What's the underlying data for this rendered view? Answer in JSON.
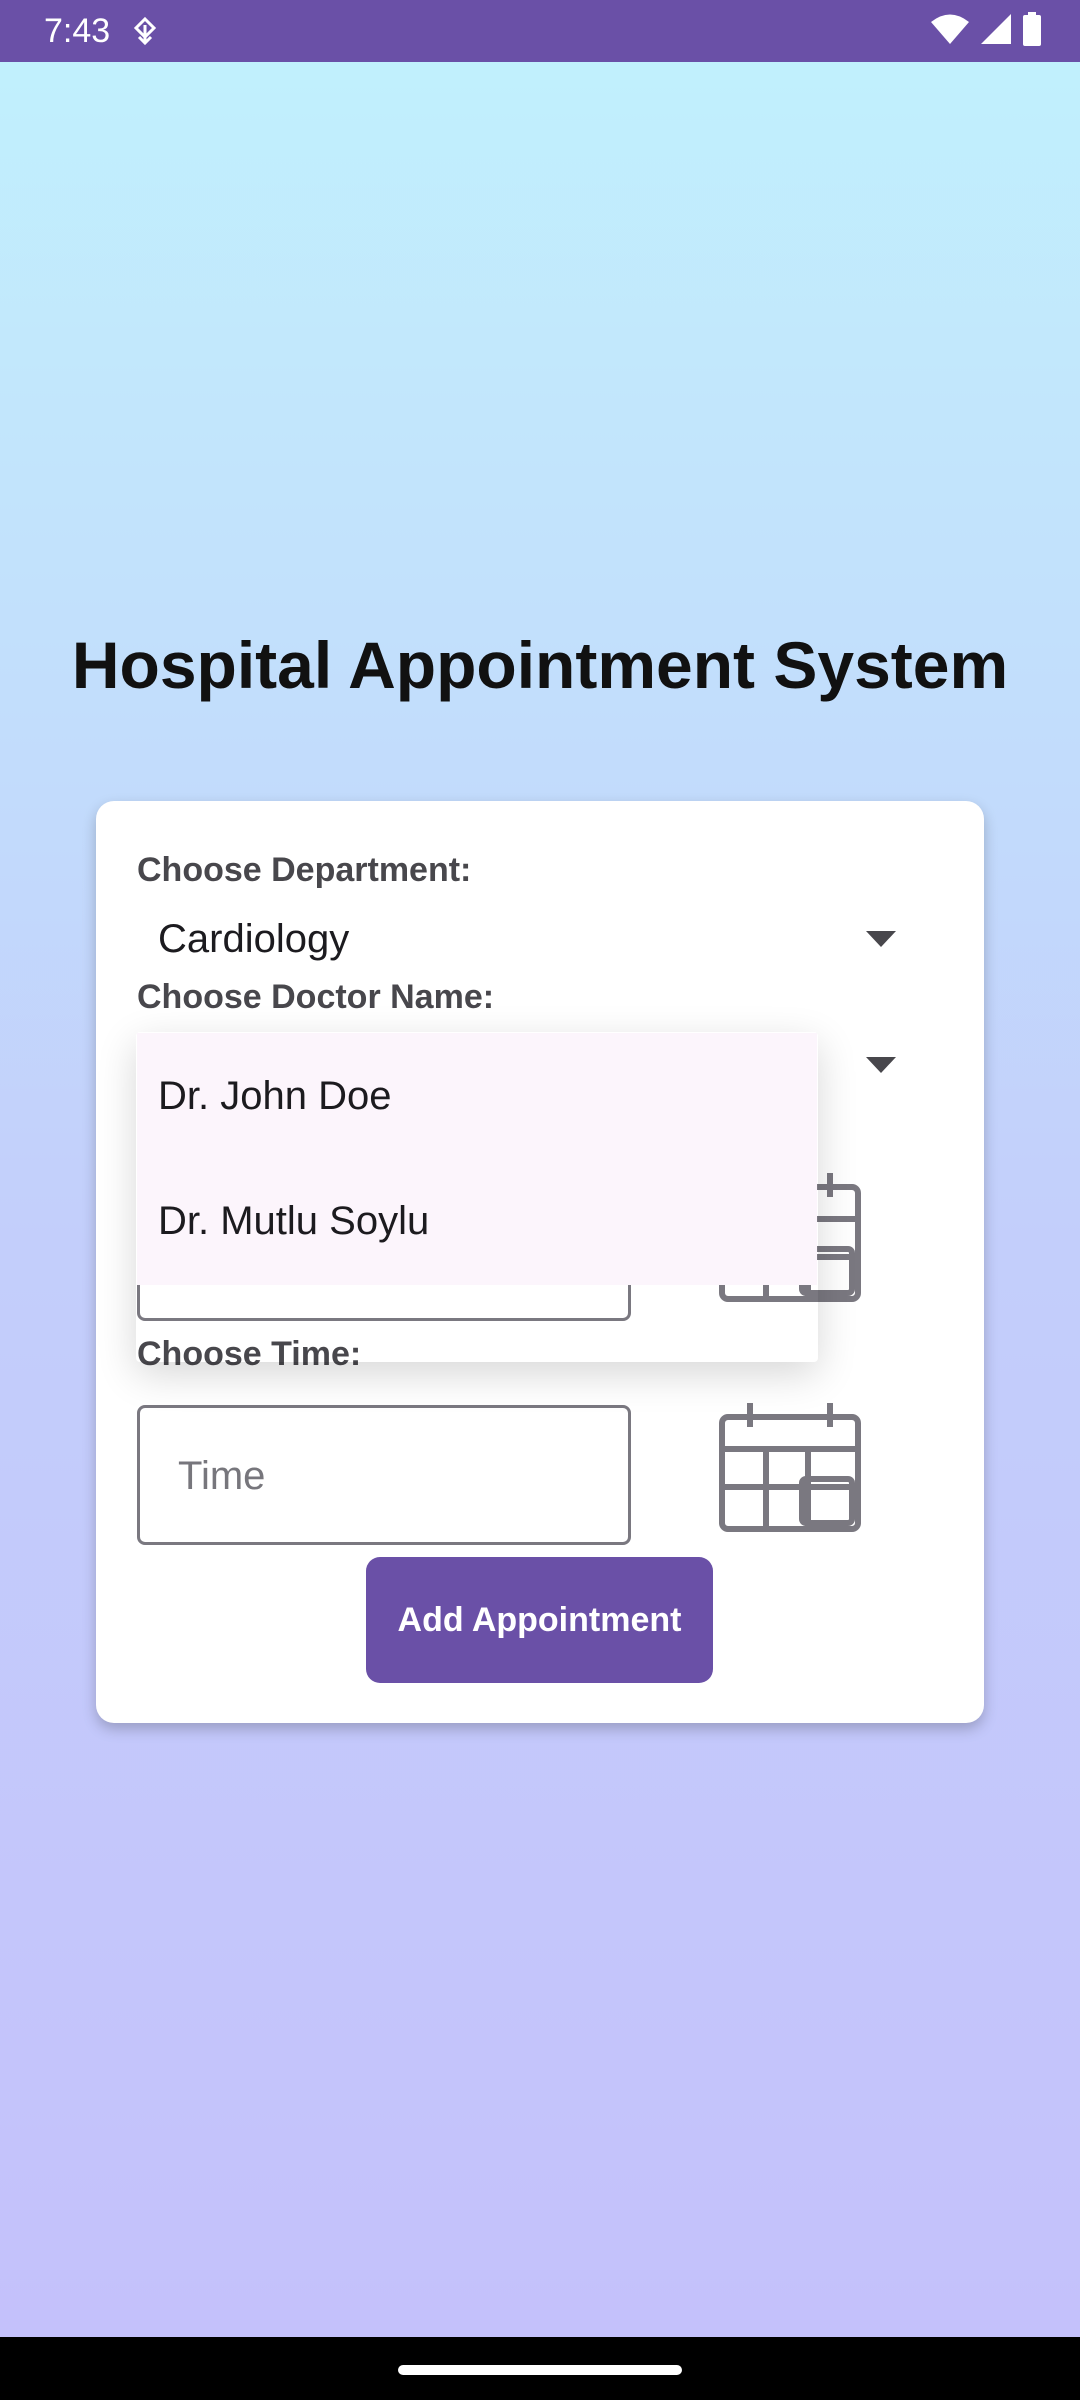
{
  "status_bar": {
    "time": "7:43",
    "notification_icon": "download-arrow-icon",
    "icons": [
      "wifi-icon",
      "cellular-signal-icon",
      "battery-icon"
    ],
    "background": "#6a50a7"
  },
  "app": {
    "title": "Hospital Appointment System"
  },
  "form": {
    "department_label": "Choose Department:",
    "department_value": "Cardiology",
    "doctor_label": "Choose Doctor Name:",
    "time_label": "Choose Time:",
    "time_placeholder": "Time",
    "date_icon": "calendar-icon",
    "time_icon": "calendar-icon",
    "add_button_label": "Add Appointment",
    "accent": "#6a50a7"
  },
  "doctor_dropdown": {
    "open": true,
    "options": [
      "Dr. John Doe",
      "Dr. Mutlu Soylu"
    ]
  }
}
